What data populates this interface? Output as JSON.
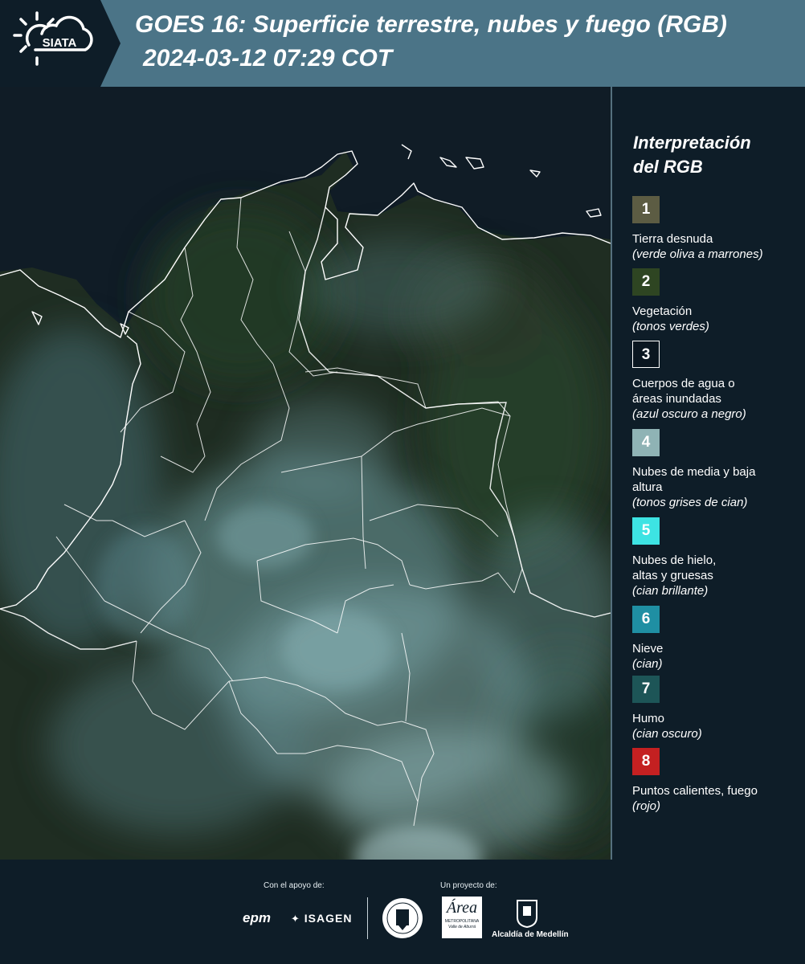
{
  "header": {
    "logo_text": "SIATA",
    "title": "GOES 16: Superficie terrestre, nubes y fuego (RGB)",
    "timestamp": "2024-03-12 07:29 COT"
  },
  "legend": {
    "title_line1": "Interpretación",
    "title_line2": "del RGB",
    "items": [
      {
        "number": "1",
        "name": "Tierra desnuda",
        "desc": "(verde oliva a marrones)",
        "color": "#5c5c43"
      },
      {
        "number": "2",
        "name": "Vegetación",
        "desc": "(tonos verdes)",
        "color": "#2e4522"
      },
      {
        "number": "3",
        "name": "Cuerpos de agua o áreas inundadas",
        "desc": "(azul oscuro a negro)",
        "color": "#0a1620"
      },
      {
        "number": "4",
        "name": "Nubes de media y baja altura",
        "desc": "(tonos grises de cian)",
        "color": "#8fb3b5"
      },
      {
        "number": "5",
        "name": "Nubes de hielo, altas y gruesas",
        "desc": "(cian brillante)",
        "color": "#3de3e3"
      },
      {
        "number": "6",
        "name": "Nieve",
        "desc": "(cian)",
        "color": "#1f8fa3"
      },
      {
        "number": "7",
        "name": "Humo",
        "desc": "(cian oscuro)",
        "color": "#1d5557"
      },
      {
        "number": "8",
        "name": "Puntos calientes, fuego",
        "desc": "(rojo)",
        "color": "#c42021"
      }
    ]
  },
  "footer": {
    "support_label": "Con el apoyo de:",
    "project_label": "Un proyecto de:",
    "sponsor_epm": "epm",
    "sponsor_isagen": "ISAGEN",
    "area_title": "Área",
    "area_sub": "METROPOLITANA",
    "area_sub2": "Valle de Aburrá",
    "alcaldia": "Alcaldía de Medellín"
  },
  "colors": {
    "header_bg": "#4b7487",
    "logo_band": "#0e1d28",
    "page_bg": "#0e1d28",
    "border": "#ffffff"
  }
}
